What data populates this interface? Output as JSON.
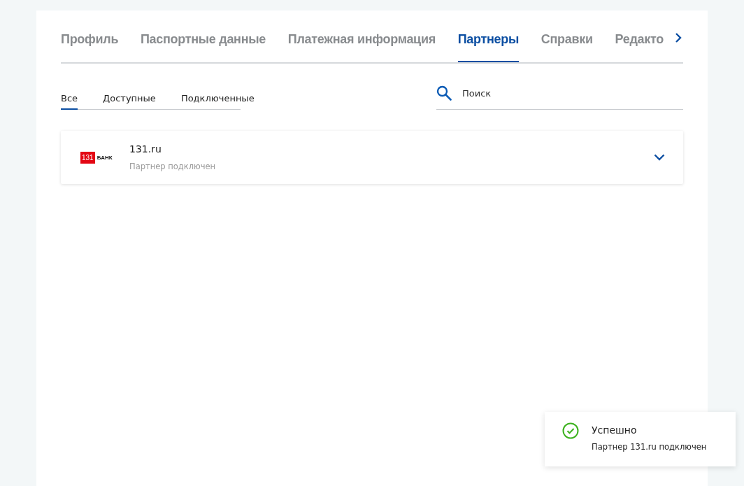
{
  "tabs": [
    {
      "label": "Профиль",
      "selected": false
    },
    {
      "label": "Паспортные данные",
      "selected": false
    },
    {
      "label": "Платежная информация",
      "selected": false
    },
    {
      "label": "Партнеры",
      "selected": true
    },
    {
      "label": "Справки",
      "selected": false
    },
    {
      "label": "Редакто",
      "selected": false
    }
  ],
  "filters": [
    {
      "label": "Все",
      "selected": true
    },
    {
      "label": "Доступные",
      "selected": false
    },
    {
      "label": "Подключенные",
      "selected": false
    }
  ],
  "search": {
    "placeholder": "Поиск"
  },
  "partners": [
    {
      "logo_number": "131",
      "logo_text": "БАНК",
      "name": "131.ru",
      "status": "Партнер подключен",
      "expanded": false
    }
  ],
  "toast": {
    "title": "Успешно",
    "message": "Партнер 131.ru подключен"
  }
}
